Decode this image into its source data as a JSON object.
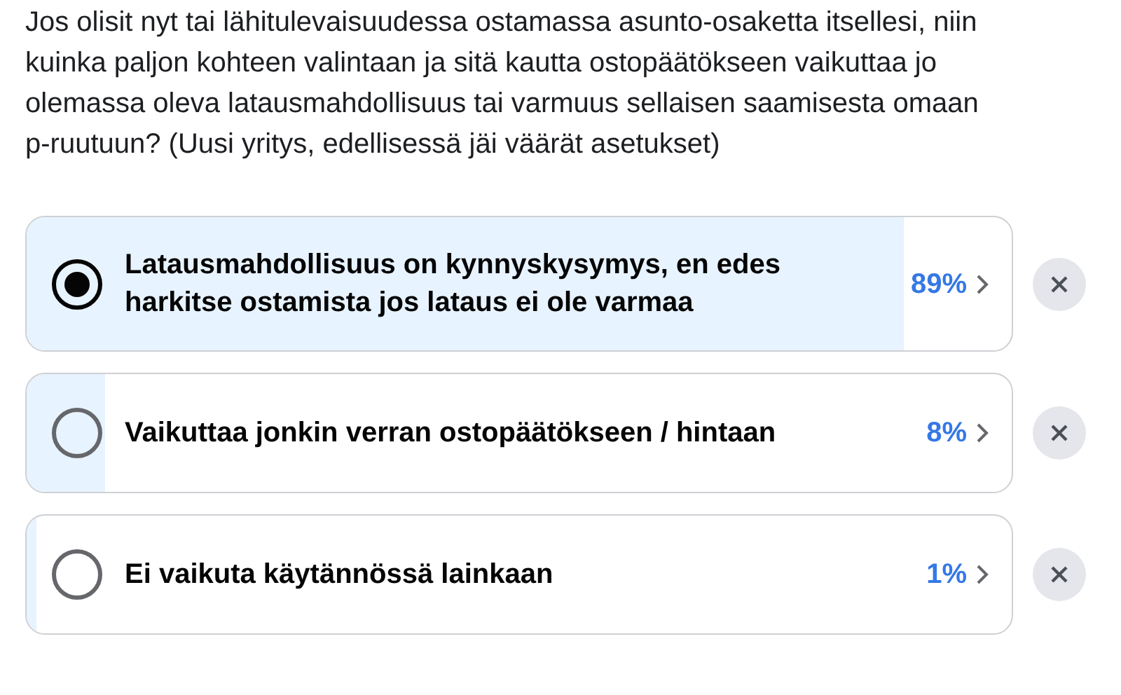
{
  "question": "Jos olisit nyt tai lähitulevaisuudessa ostamassa asunto-osaketta itsellesi, niin kuinka paljon kohteen valintaan ja sitä kautta ostopäätökseen vaikuttaa jo olemassa oleva latausmahdollisuus tai varmuus sellaisen saamisesta omaan p-ruutuun? (Uusi yritys, edellisessä jäi väärät asetukset)",
  "options": [
    {
      "label": "Latausmahdollisuus on kynnyskysymys, en edes harkitse ostamista jos lataus ei ole varmaa",
      "percent": "89%",
      "level": 0.89,
      "selected": true
    },
    {
      "label": "Vaikuttaa jonkin verran ostopäätökseen / hintaan",
      "percent": "8%",
      "level": 0.08,
      "selected": false
    },
    {
      "label": "Ei vaikuta käytännössä lainkaan",
      "percent": "1%",
      "level": 0.01,
      "selected": false
    }
  ]
}
